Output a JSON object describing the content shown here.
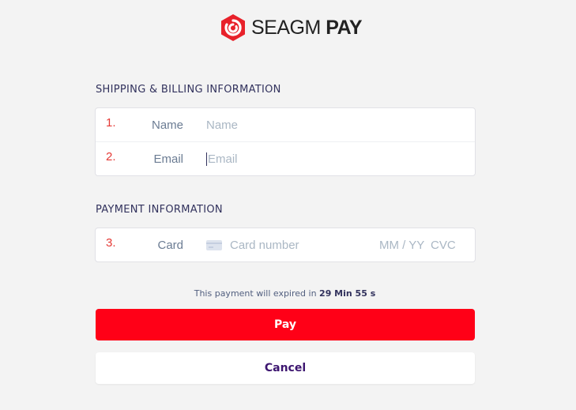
{
  "brand": {
    "name_light": "SEAGM",
    "name_bold": "PAY",
    "logo_color": "#e8212a"
  },
  "shipping": {
    "title": "SHIPPING & BILLING INFORMATION",
    "fields": [
      {
        "number": "1.",
        "label": "Name",
        "placeholder": "Name",
        "value": ""
      },
      {
        "number": "2.",
        "label": "Email",
        "placeholder": "Email",
        "value": ""
      }
    ]
  },
  "payment": {
    "title": "PAYMENT INFORMATION",
    "card": {
      "number": "3.",
      "label": "Card",
      "card_icon": "credit-card-icon",
      "card_placeholder": "Card number",
      "exp_placeholder": "MM / YY",
      "cvc_placeholder": "CVC"
    }
  },
  "expiry": {
    "prefix": "This payment will expired in",
    "time": "29 Min 55 s"
  },
  "buttons": {
    "pay": "Pay",
    "cancel": "Cancel"
  },
  "colors": {
    "pay_button": "#ff0017",
    "cancel_text": "#3d1670",
    "field_number": "#e53935"
  }
}
